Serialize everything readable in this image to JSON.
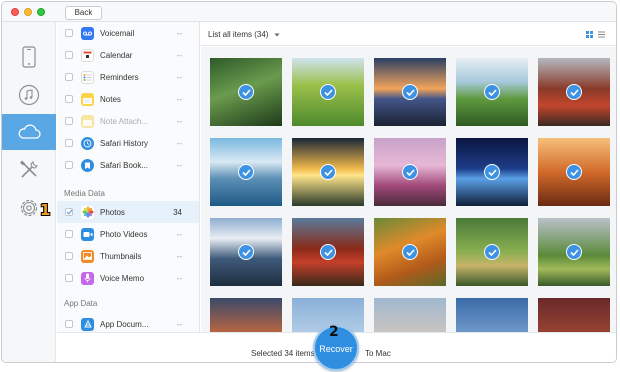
{
  "window": {
    "back_label": "Back"
  },
  "rail": {
    "items": [
      {
        "icon": "phone-icon"
      },
      {
        "icon": "music-icon"
      },
      {
        "icon": "cloud-icon",
        "active": true
      },
      {
        "icon": "tools-icon"
      },
      {
        "icon": "gear-icon"
      }
    ]
  },
  "categories": {
    "rows": [
      {
        "label": "Voicemail",
        "count": "--",
        "icon": "voicemail-icon",
        "color": "#3478f6"
      },
      {
        "label": "Calendar",
        "count": "--",
        "icon": "calendar-icon",
        "color": "#ffffff"
      },
      {
        "label": "Reminders",
        "count": "--",
        "icon": "reminders-icon",
        "color": "#ffffff"
      },
      {
        "label": "Notes",
        "count": "--",
        "icon": "notes-icon",
        "color": "#fbd44a"
      },
      {
        "label": "Note Attach...",
        "count": "--",
        "icon": "note-attach-icon",
        "color": "#f6e6a3",
        "dim": true
      },
      {
        "label": "Safari History",
        "count": "--",
        "icon": "safari-history-icon",
        "color": "#2f8ee0"
      },
      {
        "label": "Safari Book...",
        "count": "--",
        "icon": "safari-bookmarks-icon",
        "color": "#2f8ee0"
      }
    ],
    "section_media": "Media Data",
    "media_rows": [
      {
        "label": "Photos",
        "count": "34",
        "icon": "photos-icon",
        "checked": true
      },
      {
        "label": "Photo Videos",
        "count": "--",
        "icon": "photo-videos-icon",
        "color": "#2f8ee0"
      },
      {
        "label": "Thumbnails",
        "count": "--",
        "icon": "thumbnails-icon",
        "color": "#f28c2b"
      },
      {
        "label": "Voice Memo",
        "count": "--",
        "icon": "voice-memo-icon",
        "color": "#c46ae8"
      }
    ],
    "section_app": "App Data",
    "app_rows": [
      {
        "label": "App Docum...",
        "count": "--",
        "icon": "app-documents-icon",
        "color": "#2f8ee0"
      }
    ]
  },
  "main": {
    "list_label": "List all items (34)",
    "photos_total": 34
  },
  "bottom": {
    "selected_text": "Selected 34 items",
    "recover_label": "Recover",
    "to_text": "To Mac"
  },
  "steps": {
    "one": "1",
    "two": "2"
  }
}
